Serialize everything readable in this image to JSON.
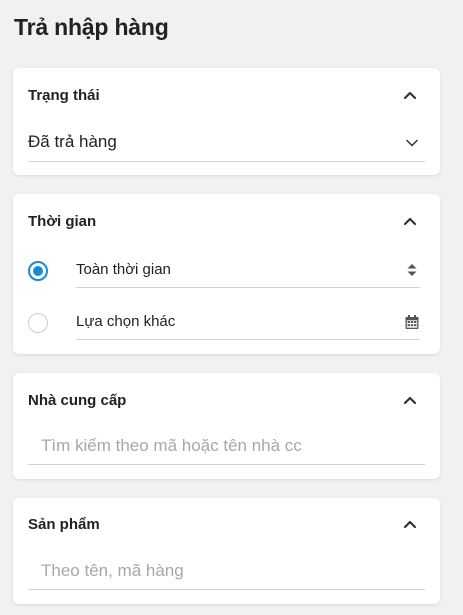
{
  "page": {
    "title": "Trả nhập hàng"
  },
  "status_panel": {
    "title": "Trạng thái",
    "selected": "Đã trả hàng"
  },
  "time_panel": {
    "title": "Thời gian",
    "options": [
      {
        "label": "Toàn thời gian",
        "checked": true,
        "icon": "sort-updown-icon"
      },
      {
        "label": "Lựa chọn khác",
        "checked": false,
        "icon": "calendar-icon"
      }
    ]
  },
  "supplier_panel": {
    "title": "Nhà cung cấp",
    "placeholder": "Tìm kiếm theo mã hoặc tên nhà cc"
  },
  "product_panel": {
    "title": "Sản phẩm",
    "placeholder": "Theo tên, mã hàng"
  },
  "colors": {
    "accent": "#1a8ad8",
    "background": "#f0f1f3",
    "placeholder": "#a4a8ad"
  }
}
